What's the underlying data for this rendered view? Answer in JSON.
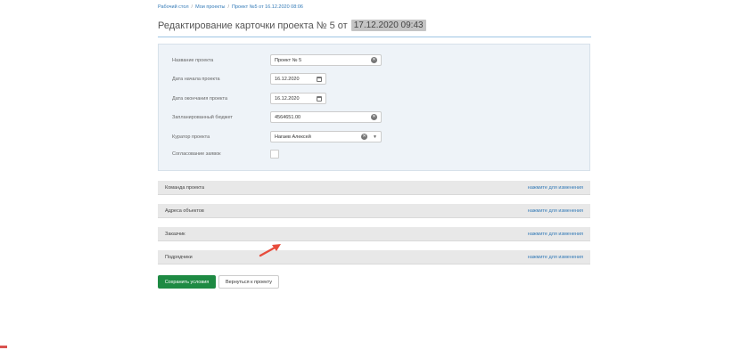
{
  "breadcrumb": {
    "items": [
      "Рабочий стол",
      "Мои проекты",
      "Проект №5 от 16.12.2020 08:06"
    ],
    "separator": "/"
  },
  "header": {
    "title": "Редактирование карточки проекта № 5 от",
    "date_badge": "17.12.2020 09:43"
  },
  "form": {
    "project_name": {
      "label": "Название проекта",
      "value": "Проект № 5",
      "icon": "clear-icon"
    },
    "start_date": {
      "label": "Дата начала проекта",
      "value": "16.12.2020",
      "icon": "calendar-icon"
    },
    "end_date": {
      "label": "Дата окончания проекта",
      "value": "16.12.2020",
      "icon": "calendar-icon"
    },
    "budget": {
      "label": "Запланированный бюджет",
      "value": "4564651.00",
      "icon": "clear-icon"
    },
    "curator": {
      "label": "Куратор проекта",
      "value": "Нагаев Алексей",
      "icon": "clear-icon"
    },
    "approval": {
      "label": "Согласование заявок",
      "checked": false
    }
  },
  "sections": [
    {
      "title": "Команда проекта",
      "link": "нажмите для изменения"
    },
    {
      "title": "Адреса объектов",
      "link": "нажмите для изменения"
    },
    {
      "title": "Заказчик",
      "link": "нажмите для изменения"
    },
    {
      "title": "Подрядчики",
      "link": "нажмите для изменения"
    }
  ],
  "buttons": {
    "save": "Сохранить условия",
    "back": "Вернуться к проекту"
  },
  "colors": {
    "accent": "#337ab7",
    "save_button": "#1e8a43",
    "panel_bg": "#eef3f8",
    "section_bg": "#e8e8e8",
    "pointer": "#e74c3c"
  }
}
